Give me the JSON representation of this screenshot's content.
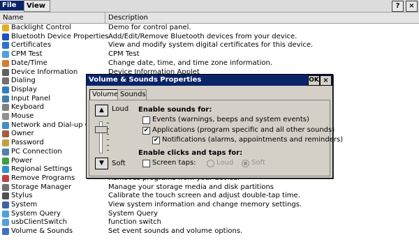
{
  "menubar": {
    "file": "File",
    "view": "View",
    "help": "?",
    "close": "×"
  },
  "list": {
    "col_name": "Name",
    "col_desc": "Description",
    "rows": [
      {
        "name": "Backlight Control",
        "desc": "Demo for control panel.",
        "icon": "#e0b020"
      },
      {
        "name": "Bluetooth Device Properties",
        "desc": "Add/Edit/Remove Bluetooth devices from your device.",
        "icon": "#2050c0"
      },
      {
        "name": "Certificates",
        "desc": "View and modify system digital certificates for this device.",
        "icon": "#3070d0"
      },
      {
        "name": "CPM Test",
        "desc": "CPM Test",
        "icon": "#50a0e0"
      },
      {
        "name": "Date/Time",
        "desc": "Change date, time, and time zone information.",
        "icon": "#d08030"
      },
      {
        "name": "Device Information",
        "desc": "Device Information Applet",
        "icon": "#606060"
      },
      {
        "name": "Dialing",
        "desc": "",
        "icon": "#707070"
      },
      {
        "name": "Display",
        "desc": "",
        "icon": "#3080c0"
      },
      {
        "name": "Input Panel",
        "desc": "",
        "icon": "#4080b0"
      },
      {
        "name": "Keyboard",
        "desc": "",
        "icon": "#808080"
      },
      {
        "name": "Mouse",
        "desc": "",
        "icon": "#909090"
      },
      {
        "name": "Network and Dial-up Conn",
        "desc": "",
        "icon": "#4090c0"
      },
      {
        "name": "Owner",
        "desc": "",
        "icon": "#a06040"
      },
      {
        "name": "Password",
        "desc": "",
        "icon": "#c0a040"
      },
      {
        "name": "PC Connection",
        "desc": "",
        "icon": "#5080b0"
      },
      {
        "name": "Power",
        "desc": "",
        "icon": "#40a040"
      },
      {
        "name": "Regional Settings",
        "desc": "",
        "icon": "#3090d0"
      },
      {
        "name": "Remove Programs",
        "desc": "Removes programs from your device.",
        "icon": "#c04040"
      },
      {
        "name": "Storage Manager",
        "desc": "Manage your storage media and disk partitions",
        "icon": "#707070"
      },
      {
        "name": "Stylus",
        "desc": "Calibrate the touch screen and adjust double-tap time.",
        "icon": "#505050"
      },
      {
        "name": "System",
        "desc": "View system information and change memory settings.",
        "icon": "#4060a0"
      },
      {
        "name": "System Query",
        "desc": "System Query",
        "icon": "#50a0e0"
      },
      {
        "name": "usbClientSwitch",
        "desc": "function switch",
        "icon": "#50a0e0"
      },
      {
        "name": "Volume & Sounds",
        "desc": "Set event sounds and volume options.",
        "icon": "#4070c0"
      }
    ]
  },
  "dialog": {
    "title": "Volume & Sounds Properties",
    "ok": "OK",
    "close": "×",
    "tabs": [
      "Volume",
      "Sounds"
    ],
    "volume_up_icon": "up-arrow-icon",
    "volume_down_icon": "down-arrow-icon",
    "loud": "Loud",
    "soft": "Soft",
    "volume_level": 0.8,
    "enable_sounds_for": "Enable sounds for:",
    "events": {
      "label": "Events (warnings, beeps and system events)",
      "checked": false
    },
    "applications": {
      "label": "Applications (program specific and all other sounds)",
      "checked": true
    },
    "notifications": {
      "label": "Notifications (alarms, appointments and reminders)",
      "checked": true
    },
    "enable_clicks": "Enable clicks and taps for:",
    "screen_taps": {
      "label": "Screen taps:",
      "checked": false
    },
    "radio_loud": "Loud",
    "radio_soft": "Soft",
    "radio_selected": "Soft"
  }
}
